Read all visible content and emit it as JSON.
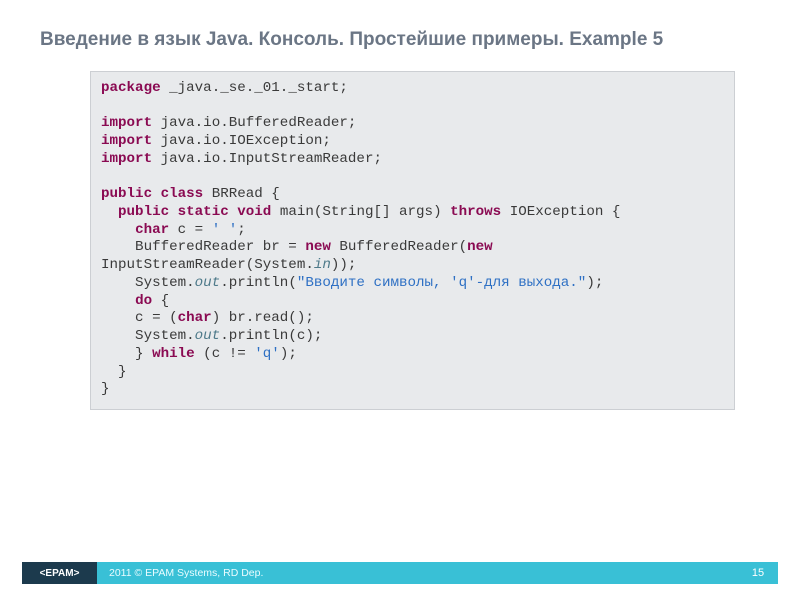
{
  "title": "Введение в язык Java. Консоль. Простейшие примеры. Example 5",
  "code": {
    "l1_kw": "package",
    "l1_rest": " _java._se._01._start;",
    "l2_kw": "import",
    "l2_rest": " java.io.BufferedReader;",
    "l3_kw": "import",
    "l3_rest": " java.io.IOException;",
    "l4_kw": "import",
    "l4_rest": " java.io.InputStreamReader;",
    "l5_kw1": "public",
    "l5_kw2": "class",
    "l5_rest": " BRRead {",
    "l6_kw1": "public",
    "l6_kw2": "static",
    "l6_kw3": "void",
    "l6_mid": " main(String[] args) ",
    "l6_kw4": "throws",
    "l6_rest": " IOException {",
    "l7_kw": "char",
    "l7_mid": " c = ",
    "l7_chr": "' '",
    "l7_end": ";",
    "l8_a": "    BufferedReader br = ",
    "l8_new1": "new",
    "l8_b": " BufferedReader(",
    "l8_new2": "new",
    "l9_a": "InputStreamReader(System.",
    "l9_in": "in",
    "l9_b": "));",
    "l10_a": "    System.",
    "l10_out": "out",
    "l10_b": ".println(",
    "l10_str": "\"Вводите символы, 'q'-для выхода.\"",
    "l10_c": ");",
    "l11_kw": "do",
    "l11_rest": " {",
    "l12_a": "    c = (",
    "l12_kw": "char",
    "l12_b": ") br.read();",
    "l13_a": "    System.",
    "l13_out": "out",
    "l13_b": ".println(c);",
    "l14_a": "    } ",
    "l14_kw": "while",
    "l14_b": " (c != ",
    "l14_chr": "'q'",
    "l14_c": ");",
    "l15": "  }",
    "l16": "}"
  },
  "footer": {
    "logo": "<EPAM>",
    "copyright": "2011 © EPAM Systems, RD Dep.",
    "page": "15"
  }
}
